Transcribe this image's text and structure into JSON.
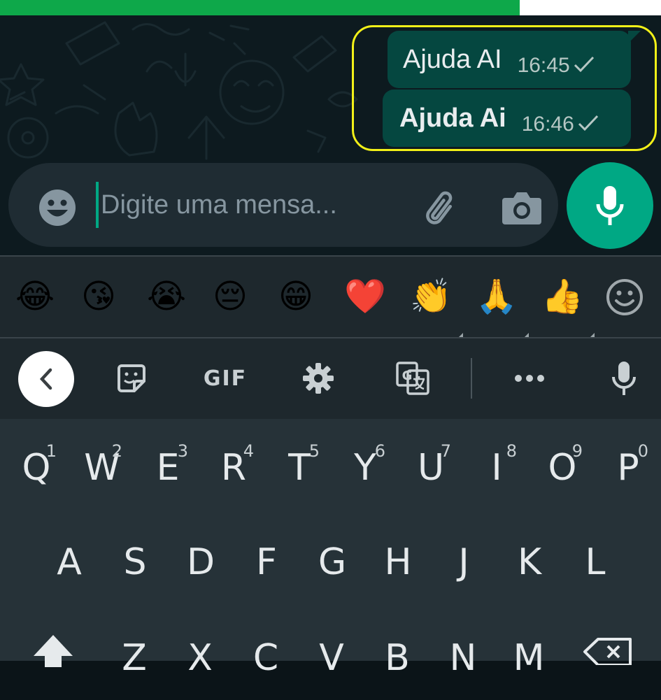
{
  "progress": {
    "fraction": 0.786
  },
  "chat": {
    "messages": [
      {
        "text": "Ajuda AI",
        "time": "16:45",
        "status": "sent-check-icon"
      },
      {
        "text": "Ajuda Ai",
        "time": "16:46",
        "status": "sent-check-icon"
      }
    ]
  },
  "composer": {
    "placeholder": "Digite uma mensa...",
    "icons": [
      "smiley-icon",
      "paperclip-icon",
      "camera-icon",
      "microphone-icon"
    ]
  },
  "emoji_bar": {
    "emojis": [
      "😂",
      "😘",
      "😭",
      "😔",
      "😁",
      "❤️",
      "👏",
      "🙏",
      "👍"
    ],
    "trailing_icon": "smiley-outline-icon"
  },
  "keyboard_toolbar": {
    "gif_label": "GIF",
    "icons": [
      "back-chevron-icon",
      "sticker-icon",
      "gear-icon",
      "translate-icon",
      "more-dots-icon",
      "microphone-icon"
    ]
  },
  "keyboard": {
    "row1": [
      {
        "key": "Q",
        "digit": "1"
      },
      {
        "key": "W",
        "digit": "2"
      },
      {
        "key": "E",
        "digit": "3"
      },
      {
        "key": "R",
        "digit": "4"
      },
      {
        "key": "T",
        "digit": "5"
      },
      {
        "key": "Y",
        "digit": "6"
      },
      {
        "key": "U",
        "digit": "7"
      },
      {
        "key": "I",
        "digit": "8"
      },
      {
        "key": "O",
        "digit": "9"
      },
      {
        "key": "P",
        "digit": "0"
      }
    ],
    "row2": [
      "A",
      "S",
      "D",
      "F",
      "G",
      "H",
      "J",
      "K",
      "L"
    ],
    "row3": [
      "Z",
      "X",
      "C",
      "V",
      "B",
      "N",
      "M"
    ]
  },
  "colors": {
    "progress": "#0ea84a",
    "bubble": "#054740",
    "accent": "#00a884",
    "highlight": "#f2f018",
    "keyboard_bg": "#263238"
  }
}
